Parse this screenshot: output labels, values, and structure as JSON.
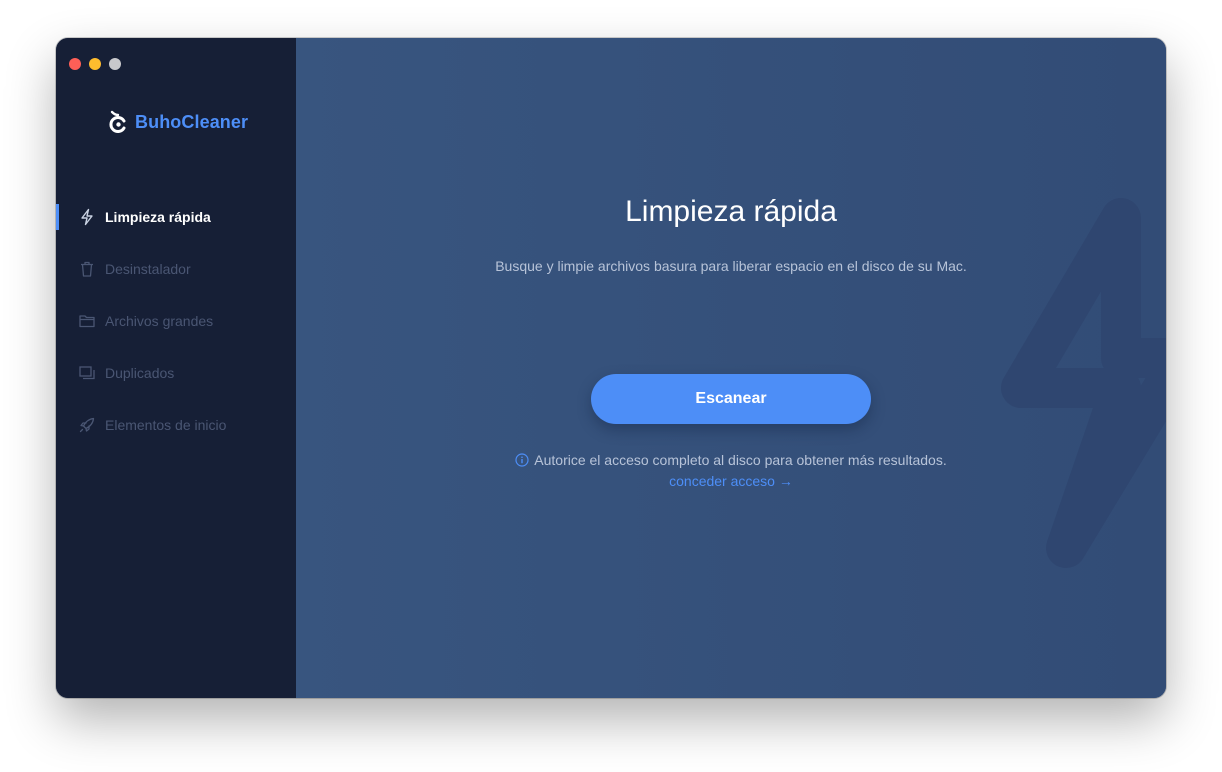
{
  "app": {
    "name": "BuhoCleaner",
    "brand_color": "#4d8ef7"
  },
  "window_controls": [
    "close",
    "minimize",
    "zoom"
  ],
  "sidebar": {
    "items": [
      {
        "label": "Limpieza rápida",
        "icon": "lightning-icon",
        "active": true
      },
      {
        "label": "Desinstalador",
        "icon": "trash-icon",
        "active": false
      },
      {
        "label": "Archivos grandes",
        "icon": "folder-icon",
        "active": false
      },
      {
        "label": "Duplicados",
        "icon": "duplicates-icon",
        "active": false
      },
      {
        "label": "Elementos de inicio",
        "icon": "rocket-icon",
        "active": false
      }
    ]
  },
  "main": {
    "title": "Limpieza rápida",
    "subtitle": "Busque y limpie archivos basura para liberar espacio en el disco de su Mac.",
    "scan_button": "Escanear",
    "notice_text": "Autorice el acceso completo al disco para obtener más resultados.",
    "grant_link": "conceder acceso →",
    "background_icon": "lightning-icon"
  },
  "colors": {
    "sidebar_bg": "#161f36",
    "main_bg": "#34507c",
    "accent": "#4d8ef7"
  }
}
